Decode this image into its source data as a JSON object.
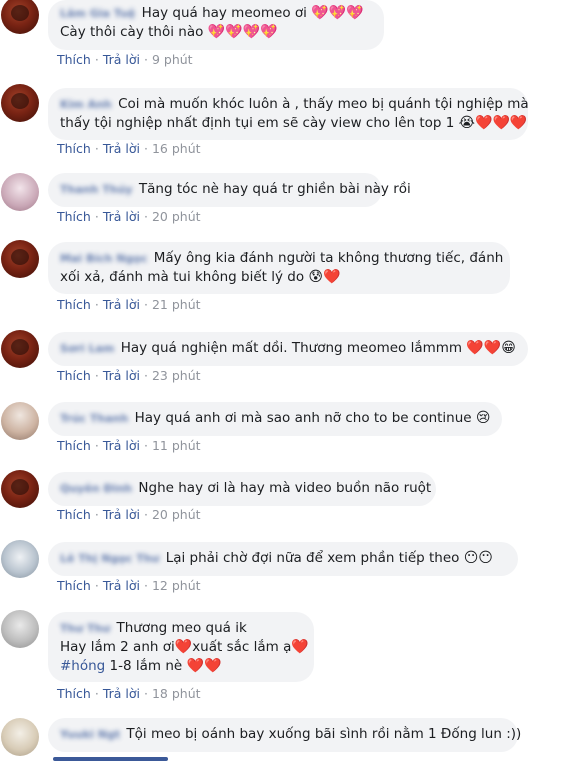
{
  "actions": {
    "like": "Thích",
    "reply": "Trả lời",
    "separator": "·"
  },
  "comments": [
    {
      "name": "Lâm Gia Tuệ",
      "line1": "Hay quá hay meomeo ơi",
      "line1_emoji": "💖💖💖",
      "line2": "Cày thôi cày thôi nào",
      "line2_emoji": "💖💖💖💖",
      "time": "9 phút"
    },
    {
      "name": "Kim Anh",
      "line1": "Coi mà muốn khóc luôn à , thấy meo bị quánh tội nghiệp mà",
      "line2": "thấy tội nghiệp nhất định tụi em sẽ cày view cho lên top 1",
      "line2_emoji": "😭❤️❤️❤️",
      "time": "16 phút"
    },
    {
      "name": "Thanh Thúy",
      "line1": "Tăng tóc nè hay quá tr ghiền bài này rồi",
      "time": "20 phút"
    },
    {
      "name": "Mai Bích Ngọc",
      "line1": "Mấy ông kia đánh người ta không thương tiếc, đánh",
      "line2": "xối xả, đánh mà tui không biết lý do",
      "line2_emoji": "😰❤️",
      "time": "21 phút"
    },
    {
      "name": "Sơri Lam",
      "line1": "Hay quá nghiện mất dồi. Thương meomeo lắmmm",
      "line1_emoji": "❤️❤️😁",
      "time": "23 phút"
    },
    {
      "name": "Trúc Thanh",
      "line1": "Hay quá anh ơi mà sao anh nỡ cho to be continue",
      "line1_emoji": "😢",
      "time": "11 phút"
    },
    {
      "name": "Quyên Đinh",
      "line1": "Nghe hay ơi là hay mà video buồn não ruột",
      "time": "20 phút"
    },
    {
      "name": "Lê Thị Ngọc Thư",
      "line1": "Lại phải chờ đợi nữa để xem phần tiếp theo",
      "line1_emoji": "😶😶",
      "time": "12 phút"
    },
    {
      "name": "Thư Thư",
      "line1": "Thương meo quá ik",
      "line2": "Hay lắm 2 anh ơi",
      "line2_emoji_a": "❤️",
      "line2_b": "xuất sắc lắm ạ",
      "line2_emoji_b": "❤️",
      "line3_hashtag": "#hóng",
      "line3": " 1-8 lắm nè",
      "line3_emoji": "❤️❤️",
      "time": "18 phút"
    },
    {
      "name": "Yuuki Ngt",
      "line1": "Tội meo bị oánh bay xuống bãi sình rồi nằm 1 Đống lun :))"
    }
  ]
}
